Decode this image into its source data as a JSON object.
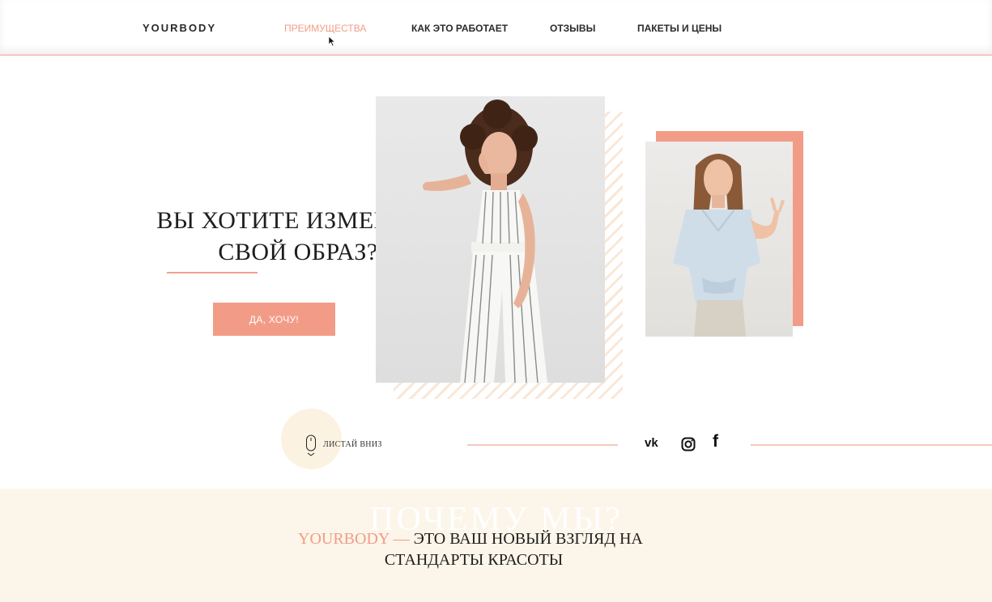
{
  "header": {
    "logo": "YOURBODY",
    "nav": [
      {
        "label": "ПРЕИМУЩЕСТВА",
        "active": true
      },
      {
        "label": "КАК ЭТО РАБОТАЕТ",
        "active": false
      },
      {
        "label": "ОТЗЫВЫ",
        "active": false
      },
      {
        "label": "ПАКЕТЫ И ЦЕНЫ",
        "active": false
      }
    ]
  },
  "hero": {
    "title_line1": "ВЫ ХОТИТЕ ИЗМЕНИТЬ",
    "title_line2": "СВОЙ ОБРАЗ?",
    "cta_label": "ДА, ХОЧУ!"
  },
  "scroll": {
    "label": "ЛИСТАЙ ВНИЗ"
  },
  "socials": [
    {
      "name": "vk",
      "label": "vk"
    },
    {
      "name": "instagram"
    },
    {
      "name": "facebook",
      "label": "f"
    }
  ],
  "why": {
    "bg_title": "ПОЧЕМУ МЫ?",
    "brand": "YOURBODY —",
    "line1_rest": " ЭТО ВАШ НОВЫЙ ВЗГЛЯД НА",
    "line2": "СТАНДАРТЫ КРАСОТЫ"
  },
  "colors": {
    "accent": "#f29c87",
    "cream": "#fcf5e9",
    "divider": "#f6c7bc"
  }
}
